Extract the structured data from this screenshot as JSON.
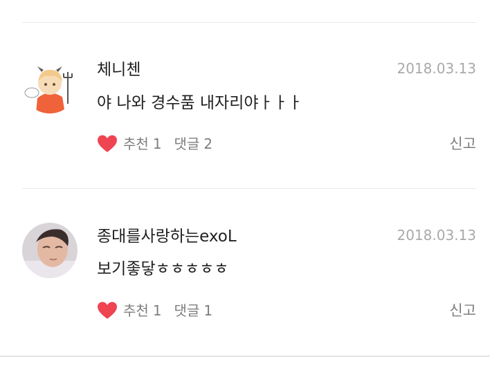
{
  "comments": [
    {
      "username": "체니첸",
      "date": "2018.03.13",
      "text": "야 나와 경수품 내자리야ㅏㅏㅏ",
      "like_label": "추천",
      "like_count": "1",
      "reply_label": "댓글",
      "reply_count": "2",
      "report_label": "신고",
      "avatar_icon": "devil-chibi-avatar-icon"
    },
    {
      "username": "종대를사랑하는exoL",
      "date": "2018.03.13",
      "text": "보기좋닿ㅎㅎㅎㅎㅎ",
      "like_label": "추천",
      "like_count": "1",
      "reply_label": "댓글",
      "reply_count": "1",
      "report_label": "신고",
      "avatar_icon": "photo-portrait-avatar-icon"
    }
  ],
  "colors": {
    "heart": "#ef4452",
    "meta_text": "#7d7d7d",
    "date_text": "#a9a9a9",
    "divider": "#e7e7e7"
  }
}
